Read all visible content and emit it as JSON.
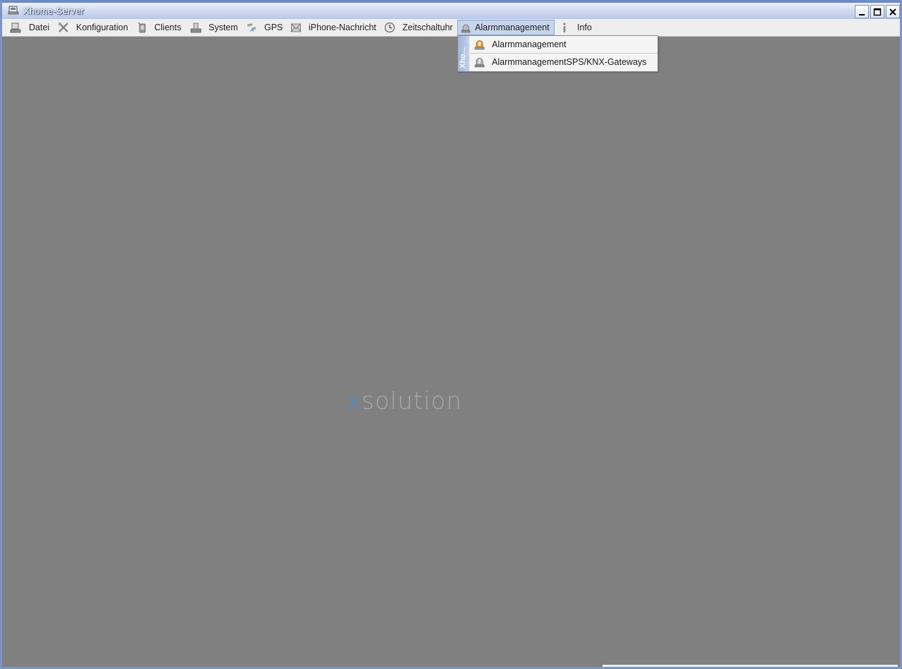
{
  "window": {
    "title": "Xhome-Server",
    "app_icon": "server-app-icon"
  },
  "menubar": {
    "items": [
      {
        "label": "Datei",
        "icon": "file-icon"
      },
      {
        "label": "Konfiguration",
        "icon": "tools-icon"
      },
      {
        "label": "Clients",
        "icon": "client-icon"
      },
      {
        "label": "System",
        "icon": "system-icon"
      },
      {
        "label": "GPS",
        "icon": "satellite-icon"
      },
      {
        "label": "iPhone-Nachricht",
        "icon": "message-icon"
      },
      {
        "label": "Zeitschaltuhr",
        "icon": "clock-icon"
      },
      {
        "label": "Alarmmanagement",
        "icon": "alarm-icon",
        "active": true
      },
      {
        "label": "Info",
        "icon": "info-icon"
      }
    ]
  },
  "dropdown": {
    "strip_label": "Xho...",
    "items": [
      {
        "label": "Alarmmanagement",
        "icon": "alarm-light-icon"
      },
      {
        "label": "AlarmmanagementSPS/KNX-Gateways",
        "icon": "alarm-gateway-icon"
      }
    ]
  },
  "logo": {
    "x_part": "x",
    "rest": "solution"
  },
  "colors": {
    "desktop": "#808080",
    "titlebar": "#b9c8e6",
    "menubar": "#eeeeee",
    "logo_accent": "#3d8fd8",
    "logo_text": "#a7a7a7"
  }
}
